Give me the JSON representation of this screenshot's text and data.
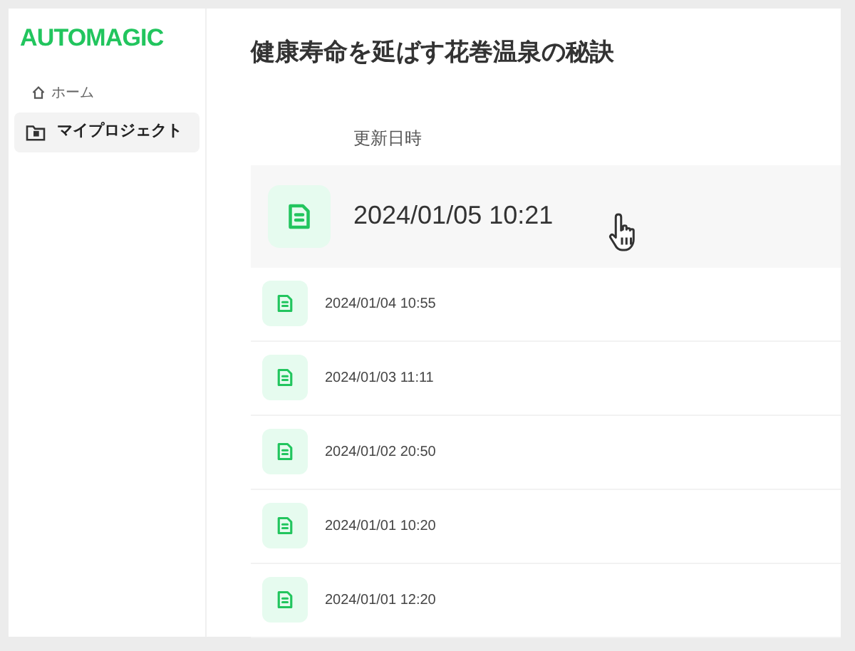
{
  "logo": "AUTOMAGIC",
  "sidebar": {
    "breadcrumb": "ホーム",
    "items": [
      {
        "label": "マイプロジェクト",
        "selected": true
      }
    ]
  },
  "page_title": "健康寿命を延ばす花巻温泉の秘訣",
  "table": {
    "columns": [
      "更新日時"
    ],
    "rows": [
      {
        "updated": "2024/01/05 10:21",
        "hovered": true
      },
      {
        "updated": "2024/01/04 10:55",
        "hovered": false
      },
      {
        "updated": "2024/01/03 11:11",
        "hovered": false
      },
      {
        "updated": "2024/01/02 20:50",
        "hovered": false
      },
      {
        "updated": "2024/01/01 10:20",
        "hovered": false
      },
      {
        "updated": "2024/01/01 12:20",
        "hovered": false
      }
    ]
  }
}
